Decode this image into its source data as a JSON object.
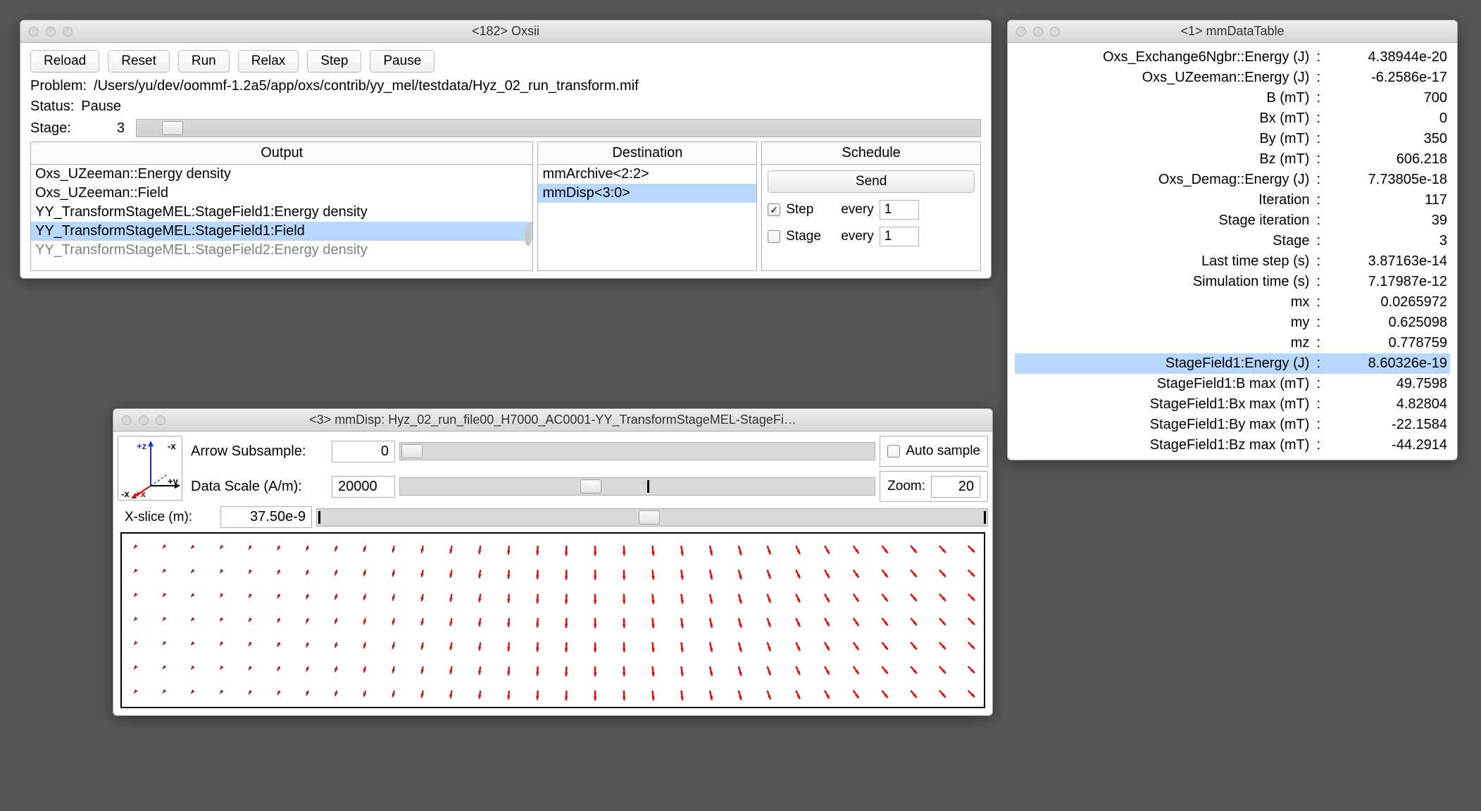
{
  "oxsii": {
    "title": "<182> Oxsii",
    "buttons": {
      "reload": "Reload",
      "reset": "Reset",
      "run": "Run",
      "relax": "Relax",
      "step": "Step",
      "pause": "Pause"
    },
    "problem_label": "Problem:",
    "problem_path": "/Users/yu/dev/oommf-1.2a5/app/oxs/contrib/yy_mel/testdata/Hyz_02_run_transform.mif",
    "status_label": "Status:",
    "status_value": "Pause",
    "stage_label": "Stage:",
    "stage_value": "3",
    "headers": {
      "output": "Output",
      "destination": "Destination",
      "schedule": "Schedule"
    },
    "outputs": [
      "Oxs_UZeeman::Energy density",
      "Oxs_UZeeman::Field",
      "YY_TransformStageMEL:StageField1:Energy density",
      "YY_TransformStageMEL:StageField1:Field"
    ],
    "outputs_partial": "YY_TransformStageMEL:StageField2:Energy density",
    "outputs_selected_index": 3,
    "destinations": [
      "mmArchive<2:2>",
      "mmDisp<3:0>"
    ],
    "destinations_selected_index": 1,
    "schedule": {
      "send": "Send",
      "step_label": "Step",
      "step_checked": true,
      "stage_label": "Stage",
      "stage_checked": false,
      "every_label": "every",
      "step_every": "1",
      "stage_every": "1"
    }
  },
  "mmdisp": {
    "title": "<3> mmDisp: Hyz_02_run_file00_H7000_AC0001-YY_TransformStageMEL-StageFi…",
    "axes": {
      "pz": "+z",
      "mx_top": "-x",
      "py": "+y",
      "px": "+x",
      "mx_bottom": "-x"
    },
    "arrow_subsample_label": "Arrow Subsample:",
    "arrow_subsample_value": "0",
    "auto_sample_label": "Auto sample",
    "auto_sample_checked": false,
    "data_scale_label": "Data Scale (A/m):",
    "data_scale_value": "20000",
    "zoom_label": "Zoom:",
    "zoom_value": "20",
    "xslice_label": "X-slice (m):",
    "xslice_value": "37.50e-9"
  },
  "datatable": {
    "title": "<1> mmDataTable",
    "rows": [
      {
        "label": "Oxs_Exchange6Ngbr::Energy (J)",
        "value": "4.38944e-20",
        "selected": false
      },
      {
        "label": "Oxs_UZeeman::Energy (J)",
        "value": "-6.2586e-17",
        "selected": false
      },
      {
        "label": "B (mT)",
        "value": "700",
        "selected": false
      },
      {
        "label": "Bx (mT)",
        "value": "0",
        "selected": false
      },
      {
        "label": "By (mT)",
        "value": "350",
        "selected": false
      },
      {
        "label": "Bz (mT)",
        "value": "606.218",
        "selected": false
      },
      {
        "label": "Oxs_Demag::Energy (J)",
        "value": "7.73805e-18",
        "selected": false
      },
      {
        "label": "Iteration",
        "value": "117",
        "selected": false
      },
      {
        "label": "Stage iteration",
        "value": "39",
        "selected": false
      },
      {
        "label": "Stage",
        "value": "3",
        "selected": false
      },
      {
        "label": "Last time step (s)",
        "value": "3.87163e-14",
        "selected": false
      },
      {
        "label": "Simulation time (s)",
        "value": "7.17987e-12",
        "selected": false
      },
      {
        "label": "mx",
        "value": "0.0265972",
        "selected": false
      },
      {
        "label": "my",
        "value": "0.625098",
        "selected": false
      },
      {
        "label": "mz",
        "value": "0.778759",
        "selected": false
      },
      {
        "label": "StageField1:Energy (J)",
        "value": "8.60326e-19",
        "selected": true
      },
      {
        "label": "StageField1:B max (mT)",
        "value": "49.7598",
        "selected": false
      },
      {
        "label": "StageField1:Bx max (mT)",
        "value": "4.82804",
        "selected": false
      },
      {
        "label": "StageField1:By max (mT)",
        "value": "-22.1584",
        "selected": false
      },
      {
        "label": "StageField1:Bz max (mT)",
        "value": "-44.2914",
        "selected": false
      }
    ]
  },
  "chart_data": {
    "type": "vector_field",
    "description": "2D slice of a 3D vector field (magnetization direction) rendered as arrows",
    "grid": {
      "cols": 30,
      "rows": 7
    },
    "arrow_angle_by_column_deg": [
      230,
      230,
      230,
      235,
      240,
      245,
      248,
      250,
      252,
      255,
      258,
      260,
      262,
      265,
      267,
      268,
      270,
      272,
      275,
      278,
      282,
      286,
      290,
      295,
      300,
      305,
      308,
      310,
      312,
      315
    ],
    "arrow_magnitude_by_column": [
      0.35,
      0.35,
      0.4,
      0.4,
      0.45,
      0.5,
      0.55,
      0.6,
      0.65,
      0.7,
      0.75,
      0.8,
      0.85,
      0.9,
      0.95,
      1.0,
      1.0,
      1.0,
      1.0,
      1.0,
      1.0,
      1.0,
      0.95,
      0.95,
      0.95,
      0.95,
      0.95,
      0.95,
      0.95,
      0.95
    ],
    "color_low": "#6b2a22",
    "color_high": "#e20d0d",
    "data_scale_A_per_m": 20000,
    "x_slice_m": 3.75e-08
  }
}
